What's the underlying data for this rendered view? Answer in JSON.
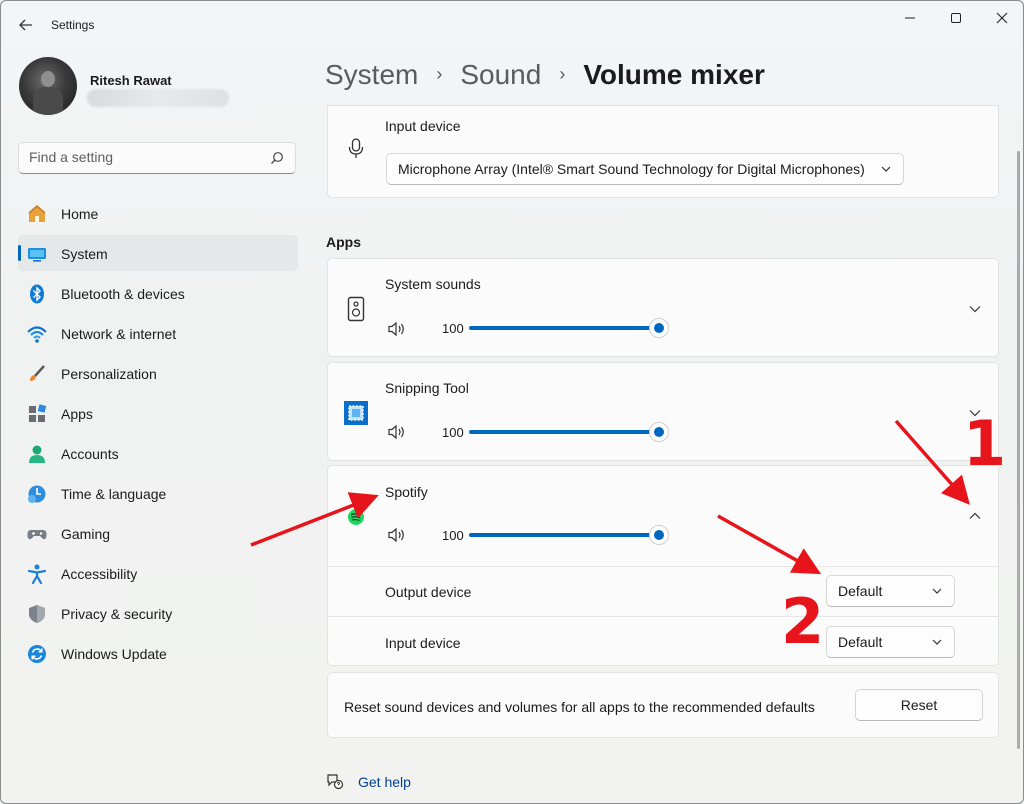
{
  "window": {
    "title": "Settings"
  },
  "profile": {
    "name": "Ritesh Rawat"
  },
  "search": {
    "placeholder": "Find a setting"
  },
  "nav": [
    {
      "label": "Home",
      "icon": "home-icon"
    },
    {
      "label": "System",
      "icon": "system-icon",
      "active": true
    },
    {
      "label": "Bluetooth & devices",
      "icon": "bluetooth-icon"
    },
    {
      "label": "Network & internet",
      "icon": "network-icon"
    },
    {
      "label": "Personalization",
      "icon": "brush-icon"
    },
    {
      "label": "Apps",
      "icon": "apps-icon"
    },
    {
      "label": "Accounts",
      "icon": "accounts-icon"
    },
    {
      "label": "Time & language",
      "icon": "time-language-icon"
    },
    {
      "label": "Gaming",
      "icon": "gaming-icon"
    },
    {
      "label": "Accessibility",
      "icon": "accessibility-icon"
    },
    {
      "label": "Privacy & security",
      "icon": "shield-icon"
    },
    {
      "label": "Windows Update",
      "icon": "update-icon"
    }
  ],
  "breadcrumb": {
    "items": [
      "System",
      "Sound"
    ],
    "current": "Volume mixer"
  },
  "input_device": {
    "title": "Input device",
    "selected": "Microphone Array (Intel® Smart Sound Technology for Digital Microphones)"
  },
  "apps": {
    "section_label": "Apps",
    "items": [
      {
        "name": "System sounds",
        "volume": 100
      },
      {
        "name": "Snipping Tool",
        "volume": 100
      },
      {
        "name": "Spotify",
        "volume": 100,
        "output_label": "Output device",
        "output_value": "Default",
        "input_label": "Input device",
        "input_value": "Default"
      }
    ]
  },
  "reset": {
    "description": "Reset sound devices and volumes for all apps to the recommended defaults",
    "button": "Reset"
  },
  "help": {
    "label": "Get help"
  },
  "annotations": {
    "one": "1",
    "two": "2"
  },
  "colors": {
    "accent": "#0067c0",
    "arrow": "#e8141b"
  }
}
